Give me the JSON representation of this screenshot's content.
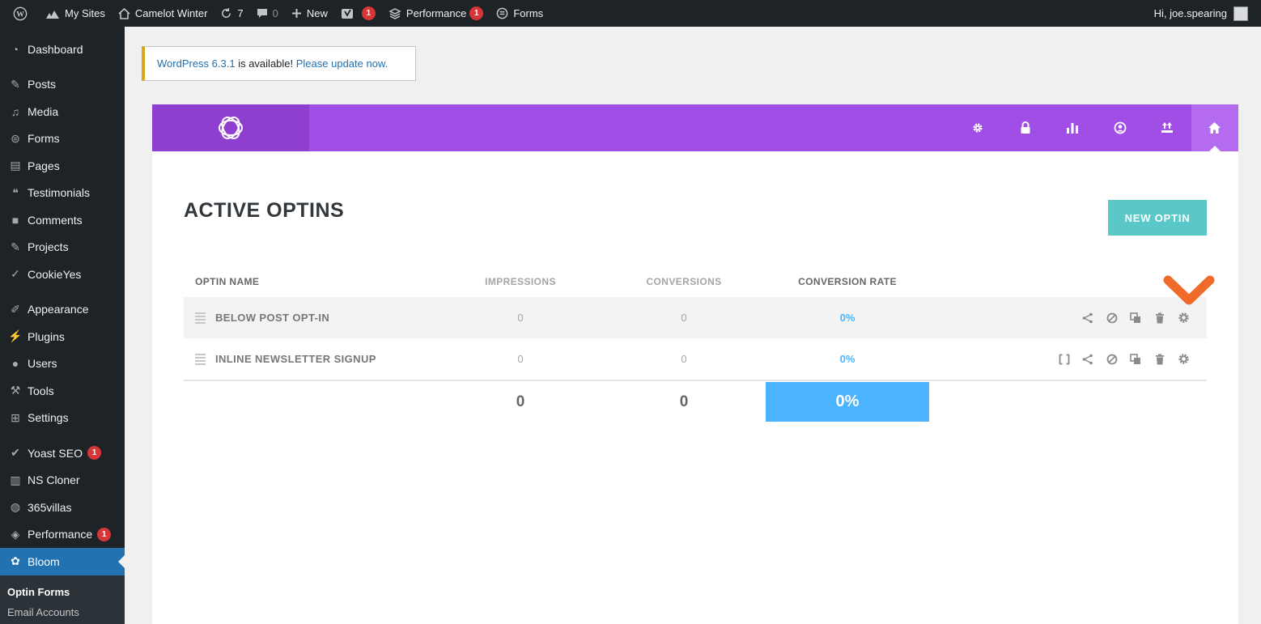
{
  "adminbar": {
    "my_sites": "My Sites",
    "site_name": "Camelot Winter",
    "updates_count": "7",
    "comments_count": "0",
    "new_label": "New",
    "yoast_badge": "1",
    "performance_label": "Performance",
    "performance_badge": "1",
    "forms_label": "Forms",
    "greeting": "Hi, joe.spearing"
  },
  "sidebar": {
    "items": [
      {
        "label": "Dashboard",
        "icon": "dashboard-icon"
      },
      {
        "label": "Posts",
        "icon": "pin-icon"
      },
      {
        "label": "Media",
        "icon": "media-icon"
      },
      {
        "label": "Forms",
        "icon": "forms-icon"
      },
      {
        "label": "Pages",
        "icon": "pages-icon"
      },
      {
        "label": "Testimonials",
        "icon": "testimonials-icon"
      },
      {
        "label": "Comments",
        "icon": "comment-icon"
      },
      {
        "label": "Projects",
        "icon": "pin-icon"
      },
      {
        "label": "CookieYes",
        "icon": "cookie-icon"
      },
      {
        "label": "Appearance",
        "icon": "brush-icon"
      },
      {
        "label": "Plugins",
        "icon": "plug-icon"
      },
      {
        "label": "Users",
        "icon": "user-icon"
      },
      {
        "label": "Tools",
        "icon": "wrench-icon"
      },
      {
        "label": "Settings",
        "icon": "settings-icon"
      },
      {
        "label": "Yoast SEO",
        "icon": "yoast-icon",
        "badge": "1"
      },
      {
        "label": "NS Cloner",
        "icon": "cloner-icon"
      },
      {
        "label": "365villas",
        "icon": "globe-icon"
      },
      {
        "label": "Performance",
        "icon": "performance-icon",
        "badge": "1"
      },
      {
        "label": "Bloom",
        "icon": "bloom-icon"
      }
    ],
    "submenu": [
      "Optin Forms",
      "Email Accounts"
    ]
  },
  "notice": {
    "version_link": "WordPress 6.3.1",
    "text": " is available! ",
    "update_link": "Please update now."
  },
  "bloom": {
    "title": "ACTIVE OPTINS",
    "new_optin_label": "NEW OPTIN",
    "nav_icons": [
      "gear-icon",
      "lock-icon",
      "stats-icon",
      "account-icon",
      "import-export-icon",
      "home-icon"
    ],
    "columns": {
      "name": "OPTIN NAME",
      "impressions": "IMPRESSIONS",
      "conversions": "CONVERSIONS",
      "rate": "CONVERSION RATE"
    },
    "rows": [
      {
        "name": "BELOW POST OPT-IN",
        "impressions": "0",
        "conversions": "0",
        "rate": "0%"
      },
      {
        "name": "INLINE NEWSLETTER SIGNUP",
        "impressions": "0",
        "conversions": "0",
        "rate": "0%"
      }
    ],
    "totals": {
      "impressions": "0",
      "conversions": "0",
      "rate": "0%"
    }
  },
  "colors": {
    "bloom_purple": "#a04ee6",
    "bloom_logo_bg": "#8f3fd0",
    "teal_button": "#5ac8c8",
    "rate_blue": "#4bb3ff",
    "callout_orange": "#f06a2a",
    "wp_admin_dark": "#1d2327",
    "wp_active_blue": "#2271b1"
  }
}
